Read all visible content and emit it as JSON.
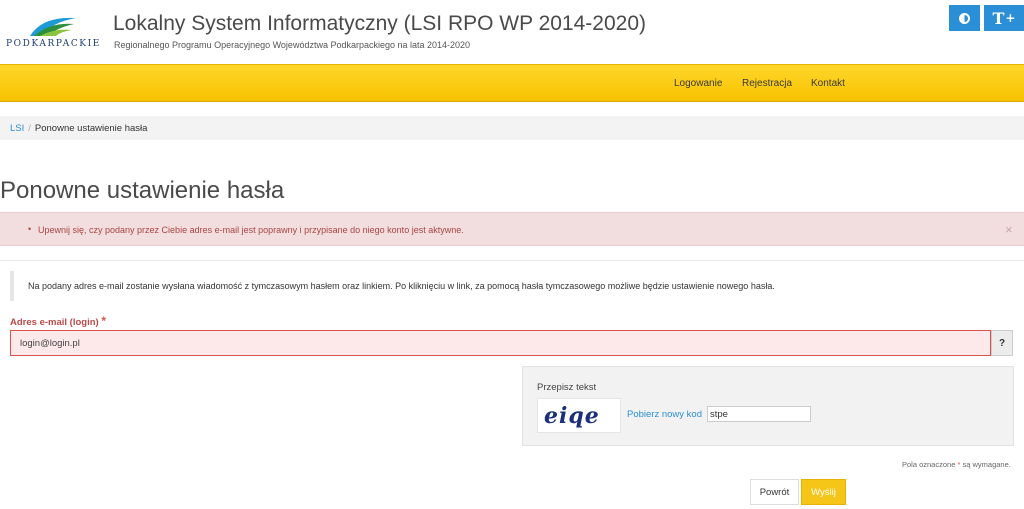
{
  "header": {
    "logo_text": "PODKARPACKIE",
    "title": "Lokalny System Informatyczny (LSI RPO WP 2014-2020)",
    "subtitle": "Regionalnego Programu Operacyjnego Województwa Podkarpackiego na lata 2014-2020",
    "contrast_icon": "contrast-icon",
    "font_size_label": "T",
    "font_size_suffix": "+"
  },
  "nav": {
    "items": [
      "Logowanie",
      "Rejestracja",
      "Kontakt"
    ]
  },
  "breadcrumb": {
    "root": "LSI",
    "separator": "/",
    "current": "Ponowne ustawienie hasła"
  },
  "page": {
    "title": "Ponowne ustawienie hasła"
  },
  "alert": {
    "bullet": "•",
    "message": "Upewnij się, czy podany przez Ciebie adres e-mail jest poprawny i przypisane do niego konto jest aktywne.",
    "close": "×"
  },
  "info": {
    "text": "Na podany adres e-mail zostanie wysłana wiadomość z tymczasowym hasłem oraz linkiem. Po kliknięciu w link, za pomocą hasła tymczasowego możliwe będzie ustawienie nowego hasła."
  },
  "form": {
    "email_label": "Adres e-mail (login)",
    "required_mark": "*",
    "email_value": "login@login.pl",
    "help_label": "?",
    "captcha_label": "Przepisz tekst",
    "captcha_image_text": "eiqe",
    "captcha_refresh": "Pobierz nowy kod",
    "captcha_value": "stpe",
    "required_note_before": "Pola oznaczone",
    "required_note_after": "są wymagane.",
    "back_button": "Powrót",
    "submit_button": "Wyślij"
  },
  "colors": {
    "accent_blue": "#2a8fd6",
    "navbar_yellow": "#f7c300",
    "alert_background": "#f2dede",
    "alert_text": "#a94442",
    "submit_yellow": "#f5c518"
  }
}
